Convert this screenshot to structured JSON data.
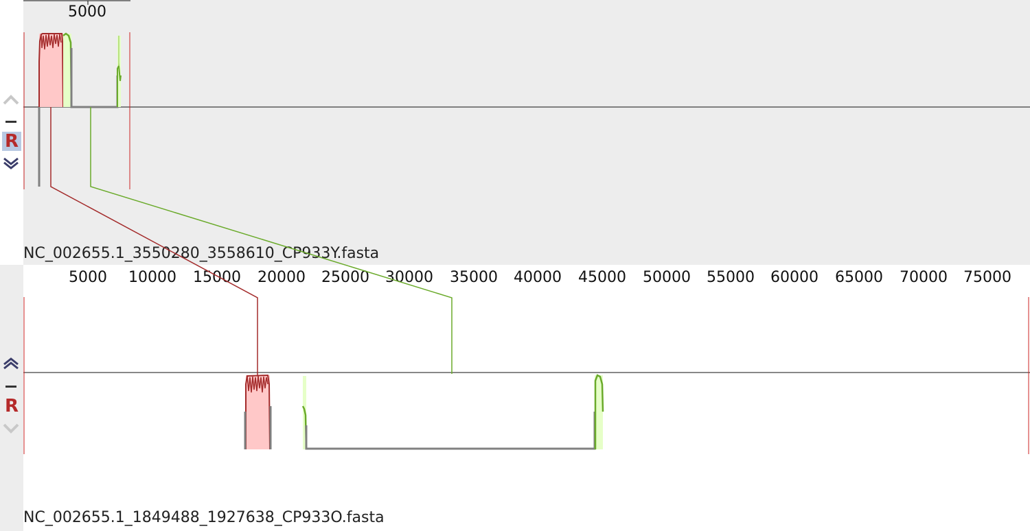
{
  "genomes": [
    {
      "name": "NC_002655.1_3550280_3558610_CP933Y.fasta",
      "ruler_ticks": [
        "5000"
      ],
      "controls": {
        "up_label": "move up",
        "minus_label": "remove",
        "r_label": "R",
        "down_label": "move down"
      }
    },
    {
      "name": "NC_002655.1_1849488_1927638_CP933O.fasta",
      "ruler_ticks": [
        "5000",
        "10000",
        "15000",
        "20000",
        "25000",
        "30000",
        "35000",
        "40000",
        "45000",
        "50000",
        "55000",
        "60000",
        "65000",
        "70000",
        "75000"
      ],
      "controls": {
        "up_label": "move up",
        "minus_label": "remove",
        "r_label": "R",
        "down_label": "move down"
      }
    }
  ],
  "colors": {
    "block_red": "#a32a2a",
    "block_red_fill": "#ffc8c8",
    "block_green": "#6aaa2a",
    "block_green_fill": "#e6ffc8",
    "backbone_gray": "#808080",
    "boundary_red": "#cc2222"
  },
  "icons": [
    "chevron-up-icon",
    "minus-icon",
    "reverse-r-icon",
    "chevron-down-icon"
  ]
}
